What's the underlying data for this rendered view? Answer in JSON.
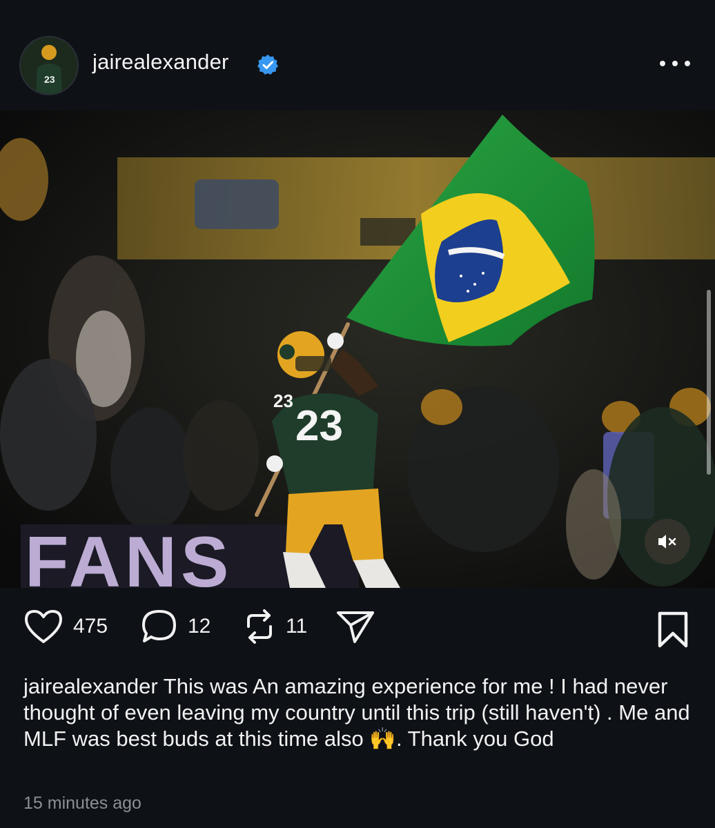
{
  "post": {
    "username": "jairealexander",
    "verified": true,
    "menu_icon": "more-horizontal-icon",
    "media": {
      "description_icon": "photo",
      "mute_icon": "volume-muted-icon"
    },
    "actions": {
      "likes": "475",
      "comments": "12",
      "reposts": "11",
      "like_icon": "heart-icon",
      "comment_icon": "speech-bubble-icon",
      "repost_icon": "repost-icon",
      "share_icon": "send-icon",
      "save_icon": "bookmark-icon"
    },
    "caption": {
      "username": "jairealexander",
      "text": "This was An amazing experience for me ! I had never thought of even leaving my country until this trip (still haven't) . Me and MLF was best buds at this time also 🙌. Thank you God"
    },
    "timestamp": "15 minutes ago"
  },
  "colors": {
    "background": "#0e1116",
    "verified_blue": "#3897f0",
    "flag_green": "#1f9a3a",
    "flag_yellow": "#f5d31a",
    "flag_blue": "#1d3f8f",
    "jersey_green": "#1f3d2a",
    "helmet_gold": "#e3a521"
  }
}
